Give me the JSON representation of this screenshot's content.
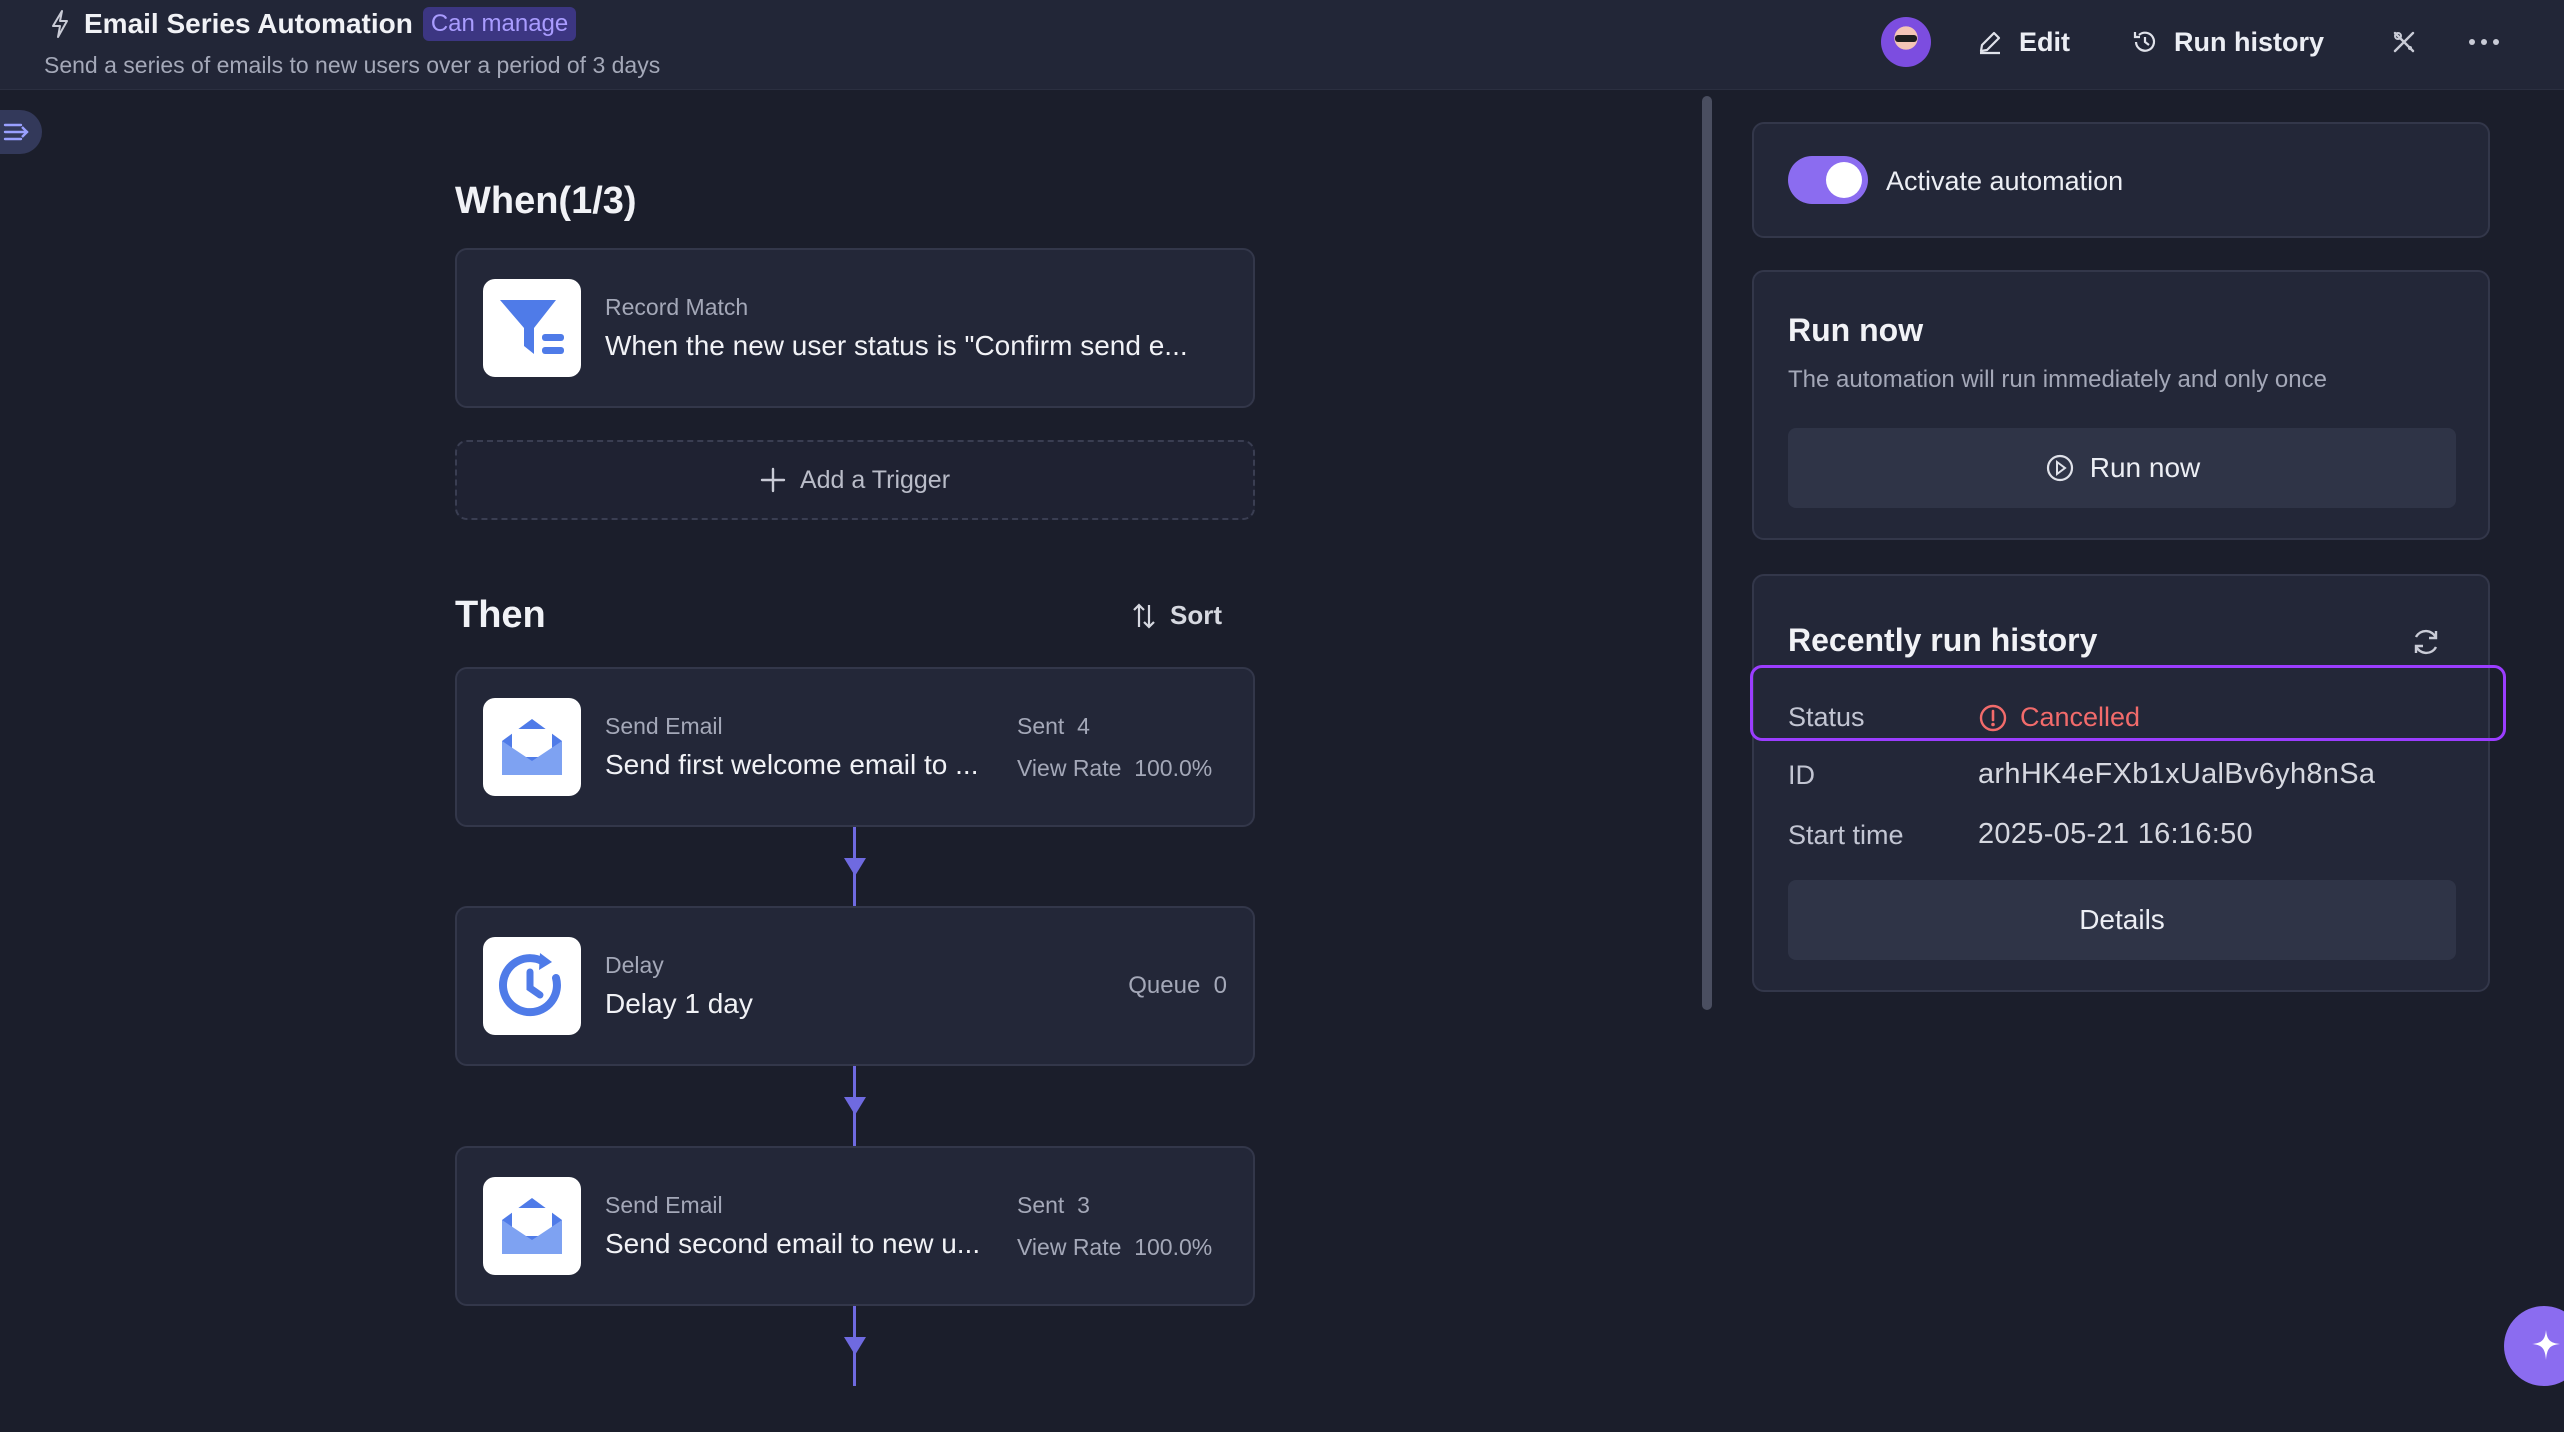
{
  "header": {
    "title": "Email Series Automation",
    "badge": "Can manage",
    "subtitle": "Send a series of emails to new users over a period of 3 days",
    "edit_label": "Edit",
    "run_history_label": "Run history"
  },
  "when": {
    "title": "When(1/3)",
    "trigger": {
      "type": "Record Match",
      "description": "When the new user status is \"Confirm send e..."
    },
    "add_trigger_label": "Add a Trigger"
  },
  "then": {
    "title": "Then",
    "sort_label": "Sort",
    "steps": [
      {
        "type": "Send Email",
        "description": "Send first welcome email to ...",
        "stat1": "Sent  4",
        "stat2": "View Rate  100.0%"
      },
      {
        "type": "Delay",
        "description": "Delay 1 day",
        "queue": "Queue  0"
      },
      {
        "type": "Send Email",
        "description": "Send second email to new u...",
        "stat1": "Sent  3",
        "stat2": "View Rate  100.0%"
      }
    ]
  },
  "activate": {
    "label": "Activate automation",
    "enabled": true
  },
  "run_now": {
    "title": "Run now",
    "description": "The automation will run immediately and only once",
    "button_label": "Run now"
  },
  "history": {
    "title": "Recently run history",
    "status_label": "Status",
    "status_value": "Cancelled",
    "id_label": "ID",
    "id_value": "arhHK4eFXb1xUalBv6yh8nSa",
    "start_label": "Start time",
    "start_value": "2025-05-21 16:16:50",
    "details_label": "Details"
  },
  "colors": {
    "accent": "#8b6cf0",
    "connector": "#6f6ae0",
    "cancelled": "#f26b6b",
    "highlight": "#9b3dff",
    "background": "#1b1e2b",
    "card": "#232738"
  }
}
